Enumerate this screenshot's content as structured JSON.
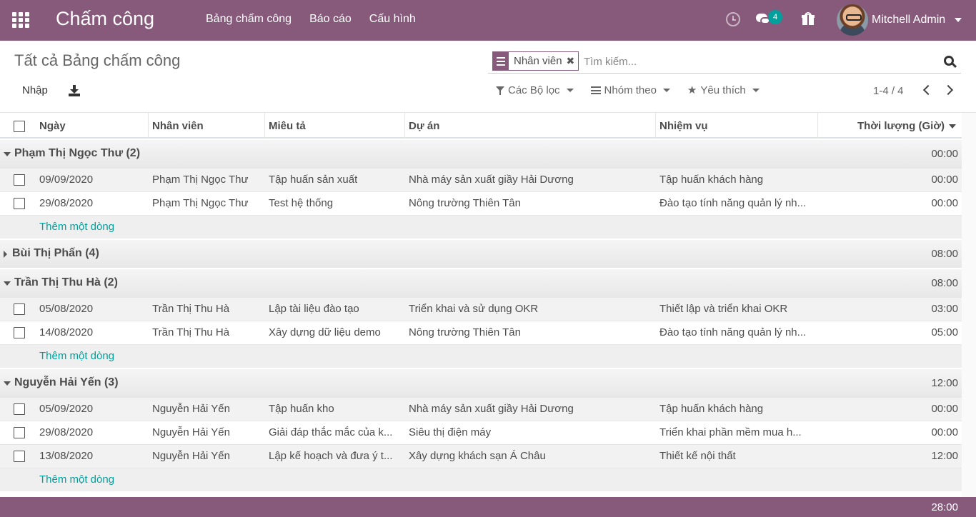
{
  "navbar": {
    "app_title": "Chấm công",
    "menu": [
      "Bảng chấm công",
      "Báo cáo",
      "Cấu hình"
    ],
    "messages_count": "4",
    "user_name": "Mitchell Admin",
    "bg_color": "#875a7b"
  },
  "control": {
    "title": "Tất cả Bảng chấm công",
    "facet_label": "Nhân viên",
    "search_placeholder": "Tìm kiếm...",
    "import_label": "Nhập",
    "filters_label": "Các Bộ lọc",
    "groupby_label": "Nhóm theo",
    "favorites_label": "Yêu thích",
    "pager": "1-4 / 4"
  },
  "table": {
    "columns": [
      "Ngày",
      "Nhân viên",
      "Miêu tả",
      "Dự án",
      "Nhiệm vụ",
      "Thời lượng (Giờ)"
    ],
    "add_line_label": "Thêm một dòng",
    "groups": [
      {
        "name": "Phạm Thị Ngọc Thư (2)",
        "total": "00:00",
        "expanded": true,
        "rows": [
          [
            "09/09/2020",
            "Phạm Thị Ngọc Thư",
            "Tập huấn sản xuất",
            "Nhà máy sản xuất giầy Hải Dương",
            "Tập huấn khách hàng",
            "00:00"
          ],
          [
            "29/08/2020",
            "Phạm Thị Ngọc Thư",
            "Test hệ thống",
            "Nông trường Thiên Tân",
            "Đào tạo tính năng quản lý nh...",
            "00:00"
          ]
        ]
      },
      {
        "name": "Bùi Thị Phấn (4)",
        "total": "08:00",
        "expanded": false,
        "rows": []
      },
      {
        "name": "Trần Thị Thu Hà (2)",
        "total": "08:00",
        "expanded": true,
        "rows": [
          [
            "05/08/2020",
            "Trần Thị Thu Hà",
            "Lập tài liệu đào tạo",
            "Triển khai và sử dụng OKR",
            "Thiết lập và triển khai OKR",
            "03:00"
          ],
          [
            "14/08/2020",
            "Trần Thị Thu Hà",
            "Xây dựng dữ liệu demo",
            "Nông trường Thiên Tân",
            "Đào tạo tính năng quản lý nh...",
            "05:00"
          ]
        ]
      },
      {
        "name": "Nguyễn Hải Yến (3)",
        "total": "12:00",
        "expanded": true,
        "rows": [
          [
            "05/09/2020",
            "Nguyễn Hải Yến",
            "Tập huấn kho",
            "Nhà máy sản xuất giầy Hải Dương",
            "Tập huấn khách hàng",
            "00:00"
          ],
          [
            "29/08/2020",
            "Nguyễn Hải Yến",
            "Giải đáp thắc mắc của k...",
            "Siêu thị điện máy",
            "Triển khai phần mềm mua h...",
            "00:00"
          ],
          [
            "13/08/2020",
            "Nguyễn Hải Yến",
            "Lập kế hoạch và đưa ý t...",
            "Xây dựng khách sạn Á Châu",
            "Thiết kế nội thất",
            "12:00"
          ]
        ]
      }
    ],
    "grand_total": "28:00"
  }
}
